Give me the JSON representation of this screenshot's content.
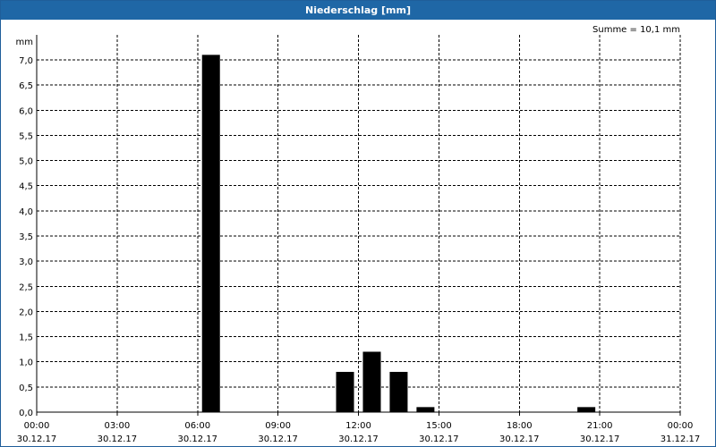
{
  "window": {
    "title": "Niederschlag [mm]"
  },
  "summary": "Summe = 10,1 mm",
  "chart_data": {
    "type": "bar",
    "title": "Niederschlag [mm]",
    "ylabel": "mm",
    "xlabel": "",
    "ylim": [
      0,
      7.0
    ],
    "yticks": [
      "0,0",
      "0,5",
      "1,0",
      "1,5",
      "2,0",
      "2,5",
      "3,0",
      "3,5",
      "4,0",
      "4,5",
      "5,0",
      "5,5",
      "6,0",
      "6,5",
      "7,0"
    ],
    "xlim": [
      0,
      24
    ],
    "xticks": [
      {
        "time": "00:00",
        "date": "30.12.17"
      },
      {
        "time": "03:00",
        "date": "30.12.17"
      },
      {
        "time": "06:00",
        "date": "30.12.17"
      },
      {
        "time": "09:00",
        "date": "30.12.17"
      },
      {
        "time": "12:00",
        "date": "30.12.17"
      },
      {
        "time": "15:00",
        "date": "30.12.17"
      },
      {
        "time": "18:00",
        "date": "30.12.17"
      },
      {
        "time": "21:00",
        "date": "30.12.17"
      },
      {
        "time": "00:00",
        "date": "31.12.17"
      }
    ],
    "grid": true,
    "bar_color": "#000000",
    "series": [
      {
        "x": [
          6.5,
          11.5,
          12.5,
          13.5,
          14.5,
          20.5
        ],
        "values": [
          7.1,
          0.8,
          1.2,
          0.8,
          0.1,
          0.1
        ]
      }
    ]
  }
}
